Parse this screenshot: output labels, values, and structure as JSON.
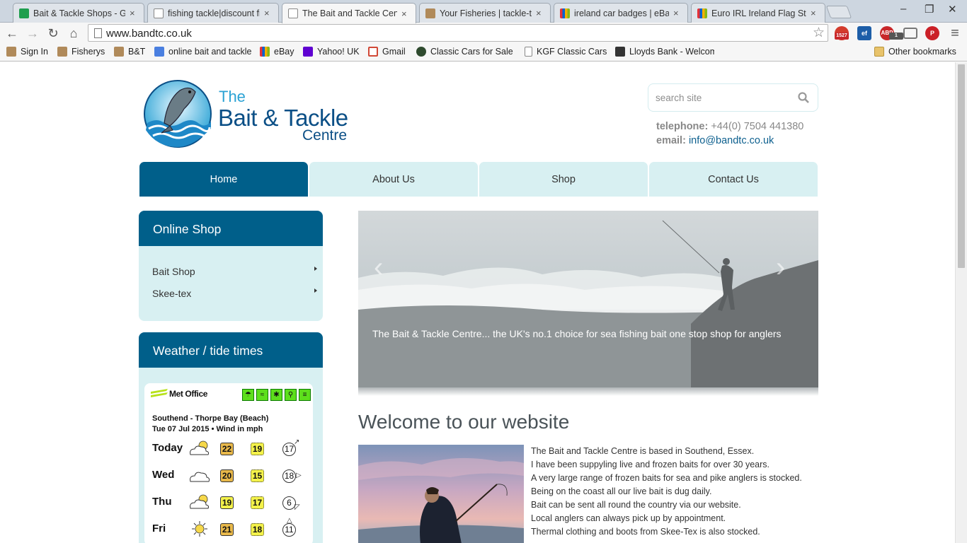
{
  "browser": {
    "tabs": [
      {
        "title": "Bait & Tackle Shops - Go",
        "icon_color": "#1e9e4e"
      },
      {
        "title": "fishing tackle|discount fi",
        "icon_color": "#ffffff"
      },
      {
        "title": "The Bait and Tackle Cen",
        "icon_color": "#ffffff",
        "active": true
      },
      {
        "title": "Your Fisheries | tackle-tr",
        "icon_color": "#b08a5a"
      },
      {
        "title": "ireland car badges | eBay",
        "icon_color": "#e53238"
      },
      {
        "title": "Euro IRL Ireland Flag Sta",
        "icon_color": "#e53238"
      }
    ],
    "close_glyph": "×",
    "window_controls": {
      "minimize": "–",
      "restore": "❐",
      "close": "✕"
    },
    "nav": {
      "back": "←",
      "forward": "→",
      "reload": "↻",
      "home": "⌂"
    },
    "url": "www.bandtc.co.uk",
    "star": "☆",
    "extensions": [
      {
        "label": "",
        "badge": "1527",
        "color": "#d33b2c"
      },
      {
        "label": "ef",
        "badge": "",
        "color": "#1d5ea8"
      },
      {
        "label": "ABP",
        "badge": "1",
        "color": "#c8272a"
      },
      {
        "label": "",
        "badge": "",
        "color": "#777777"
      },
      {
        "label": "P",
        "badge": "",
        "color": "#cb2027"
      }
    ],
    "menu_glyph": "≡",
    "bookmarks": [
      {
        "label": "Sign In",
        "icon_color": "#b08a5a"
      },
      {
        "label": "Fisherys",
        "icon_color": "#b08a5a"
      },
      {
        "label": "B&T",
        "icon_color": "#b08a5a"
      },
      {
        "label": "online bait and tackle",
        "icon_color": "#4a7fe0"
      },
      {
        "label": "eBay",
        "icon_color": "#e53238"
      },
      {
        "label": "Yahoo! UK",
        "icon_color": "#5f01d1"
      },
      {
        "label": "Gmail",
        "icon_color": "#d14836"
      },
      {
        "label": "Classic Cars for Sale",
        "icon_color": "#2e4a2e"
      },
      {
        "label": "KGF Classic Cars",
        "icon_color": "#ffffff"
      },
      {
        "label": "Lloyds Bank - Welcom",
        "icon_color": "#333333"
      }
    ],
    "other_bookmarks": "Other bookmarks"
  },
  "site": {
    "logo": {
      "the": "The",
      "main": "Bait & Tackle",
      "sub": "Centre"
    },
    "search_placeholder": "search site",
    "contact": {
      "tel_label": "telephone:",
      "tel_value": "+44(0) 7504 441380",
      "email_label": "email:",
      "email_value": "info@bandtc.co.uk"
    },
    "nav": [
      "Home",
      "About Us",
      "Shop",
      "Contact Us"
    ],
    "online_shop": {
      "title": "Online Shop",
      "items": [
        "Bait Shop",
        "Skee-tex"
      ]
    },
    "weather": {
      "title": "Weather / tide times",
      "provider": "Met Office",
      "location": "Southend - Thorpe Bay (Beach)",
      "date_line": "Tue 07 Jul 2015 • Wind in mph",
      "days": [
        {
          "day": "Today",
          "icon": "sun-cloud",
          "max": "22",
          "min": "19",
          "wind": "17",
          "dir": "↗"
        },
        {
          "day": "Wed",
          "icon": "cloud",
          "max": "20",
          "min": "15",
          "wind": "18",
          "dir": "▷"
        },
        {
          "day": "Thu",
          "icon": "sun-cloud",
          "max": "19",
          "min": "17",
          "wind": "6",
          "dir": "◸"
        },
        {
          "day": "Fri",
          "icon": "sun",
          "max": "21",
          "min": "18",
          "wind": "11",
          "dir": "△"
        }
      ]
    },
    "slider": {
      "caption": "The Bait & Tackle Centre... the UK's no.1 choice for sea fishing bait one stop shop for anglers",
      "prev": "‹",
      "next": "›"
    },
    "welcome_title": "Welcome to our website",
    "welcome_lines": [
      "The Bait and Tackle Centre is based in Southend, Essex.",
      "I have been suppyling live and frozen baits for over 30 years.",
      "A very large range of frozen baits for sea and pike anglers is stocked.",
      "Being on the coast all our live bait is dug daily.",
      "Bait can be sent all round the country via our website.",
      "Local anglers can always pick up by appointment.",
      "Thermal clothing and boots from Skee-Tex is also stocked."
    ]
  },
  "colors": {
    "primary": "#005f8a",
    "tab_light": "#d8f0f2",
    "met_green": "#5ddf1c",
    "max_temp": "#e8b84a",
    "min_temp": "#f4f24a"
  }
}
